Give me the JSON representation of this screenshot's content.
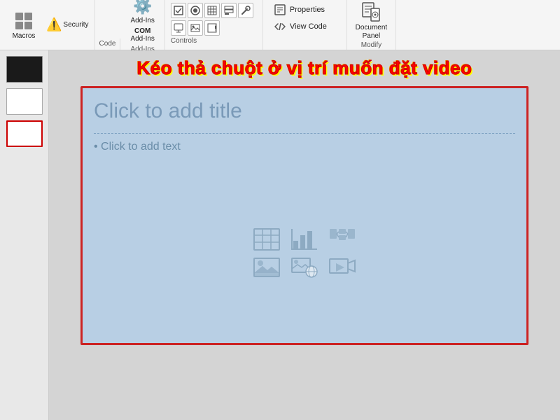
{
  "ribbon": {
    "groups": {
      "code": {
        "label": "Code",
        "macros_label": "Macros",
        "security_label": "Security",
        "com_line1": "COM",
        "com_line2": "Add-Ins",
        "addins_label": "Add-Ins"
      },
      "controls": {
        "label": "Controls",
        "checkbox_symbol": "✔",
        "radio_symbol": "◉"
      },
      "view": {
        "properties_label": "Properties",
        "view_code_label": "View Code"
      },
      "modify": {
        "line1": "Document",
        "line2": "Panel",
        "label": "Modify"
      }
    }
  },
  "instruction": {
    "text": "Kéo thả chuột ở vị trí muốn đặt video"
  },
  "slide": {
    "title_placeholder": "Click to add title",
    "content_placeholder": "• Click to add text"
  },
  "sidebar": {
    "thumbs": [
      "black",
      "white",
      "red-border"
    ]
  }
}
